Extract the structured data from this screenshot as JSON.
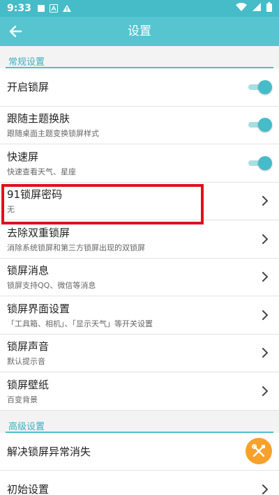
{
  "status_bar": {
    "time": "9:33",
    "icons": [
      "square-icon",
      "a-notification-icon",
      "warning-icon",
      "wifi-icon",
      "signal-icon",
      "battery-icon"
    ]
  },
  "app_bar": {
    "title": "设置",
    "back_icon": "back-arrow-icon"
  },
  "sections": {
    "general": {
      "header": "常规设置",
      "items": [
        {
          "title": "开启锁屏",
          "subtitle": "",
          "control": "toggle",
          "on": true
        },
        {
          "title": "跟随主题换肤",
          "subtitle": "跟随桌面主题变换锁屏样式",
          "control": "toggle",
          "on": true
        },
        {
          "title": "快速屏",
          "subtitle": "快速查看天气、星座",
          "control": "toggle",
          "on": true
        },
        {
          "title": "91锁屏密码",
          "subtitle": "无",
          "control": "chevron"
        },
        {
          "title": "去除双重锁屏",
          "subtitle": "消除系统锁屏和第三方锁屏出现的双锁屏",
          "control": "chevron"
        },
        {
          "title": "锁屏消息",
          "subtitle": "锁屏支持QQ、微信等消息",
          "control": "chevron"
        },
        {
          "title": "锁屏界面设置",
          "subtitle": "「工具箱、相机」、「显示天气」等开关设置",
          "control": "chevron"
        },
        {
          "title": "锁屏声音",
          "subtitle": "默认提示音",
          "control": "chevron"
        },
        {
          "title": "锁屏壁纸",
          "subtitle": "百变背景",
          "control": "chevron"
        }
      ]
    },
    "advanced": {
      "header": "高级设置",
      "items": [
        {
          "title": "解决锁屏异常消失",
          "subtitle": "",
          "control": "fab",
          "icon": "tools-icon"
        },
        {
          "title": "初始设置",
          "subtitle": "",
          "control": "chevron"
        }
      ]
    }
  },
  "colors": {
    "accent": "#56c5d0",
    "status_bar": "#45bcc8",
    "highlight": "#e0101d",
    "fab": "#f7a12b"
  }
}
